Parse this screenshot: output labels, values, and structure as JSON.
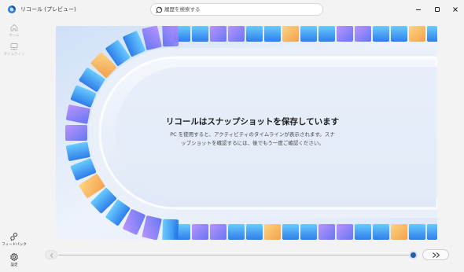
{
  "window": {
    "title": "リコール (プレビュー)",
    "controls": [
      "minimize",
      "maximize",
      "close"
    ]
  },
  "search": {
    "placeholder": "履歴を検索する",
    "icon": "search-icon"
  },
  "nav": {
    "home_label": "ホーム",
    "timeline_label": "タイムライン",
    "feedback_label": "フィードバック",
    "settings_label": "設定"
  },
  "main": {
    "title": "リコールはスナップショットを保存しています",
    "description": "PC を使用すると、アクティビティのタイムラインが表示されます。スナップショットを確認するには、後でもう一度ご確認ください。"
  },
  "timeline": {
    "position": 1.0
  },
  "colors": {
    "accent": "#1f5ea8",
    "background": "#f3f3f3"
  }
}
